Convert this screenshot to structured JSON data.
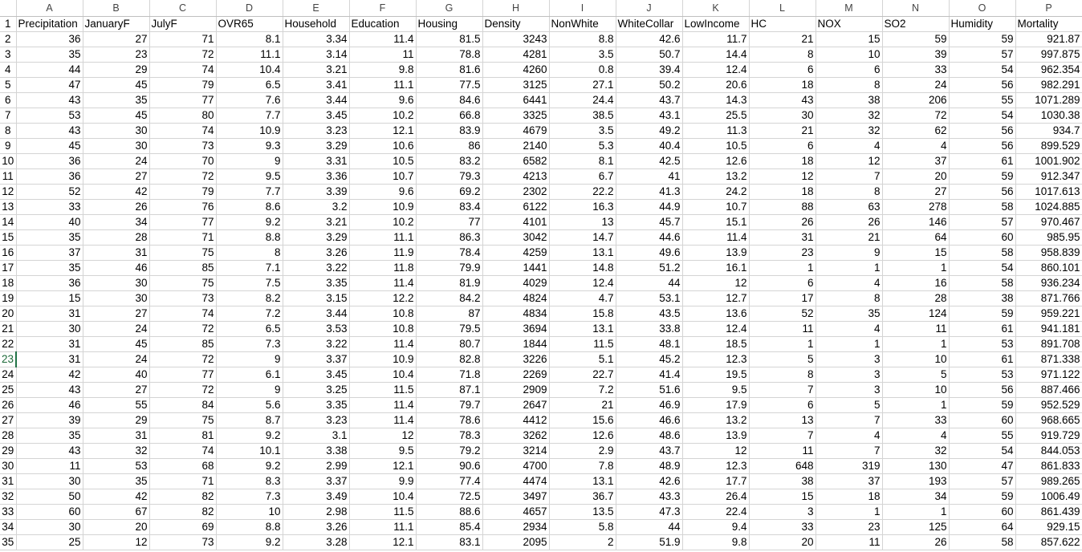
{
  "columns": [
    "A",
    "B",
    "C",
    "D",
    "E",
    "F",
    "G",
    "H",
    "I",
    "J",
    "K",
    "L",
    "M",
    "N",
    "O",
    "P"
  ],
  "headers": [
    "Precipitation",
    "JanuaryF",
    "JulyF",
    "OVR65",
    "Household",
    "Education",
    "Housing",
    "Density",
    "NonWhite",
    "WhiteCollar",
    "LowIncome",
    "HC",
    "NOX",
    "SO2",
    "Humidity",
    "Mortality"
  ],
  "selected_row": 23,
  "rows": [
    [
      "36",
      "27",
      "71",
      "8.1",
      "3.34",
      "11.4",
      "81.5",
      "3243",
      "8.8",
      "42.6",
      "11.7",
      "21",
      "15",
      "59",
      "59",
      "921.87"
    ],
    [
      "35",
      "23",
      "72",
      "11.1",
      "3.14",
      "11",
      "78.8",
      "4281",
      "3.5",
      "50.7",
      "14.4",
      "8",
      "10",
      "39",
      "57",
      "997.875"
    ],
    [
      "44",
      "29",
      "74",
      "10.4",
      "3.21",
      "9.8",
      "81.6",
      "4260",
      "0.8",
      "39.4",
      "12.4",
      "6",
      "6",
      "33",
      "54",
      "962.354"
    ],
    [
      "47",
      "45",
      "79",
      "6.5",
      "3.41",
      "11.1",
      "77.5",
      "3125",
      "27.1",
      "50.2",
      "20.6",
      "18",
      "8",
      "24",
      "56",
      "982.291"
    ],
    [
      "43",
      "35",
      "77",
      "7.6",
      "3.44",
      "9.6",
      "84.6",
      "6441",
      "24.4",
      "43.7",
      "14.3",
      "43",
      "38",
      "206",
      "55",
      "1071.289"
    ],
    [
      "53",
      "45",
      "80",
      "7.7",
      "3.45",
      "10.2",
      "66.8",
      "3325",
      "38.5",
      "43.1",
      "25.5",
      "30",
      "32",
      "72",
      "54",
      "1030.38"
    ],
    [
      "43",
      "30",
      "74",
      "10.9",
      "3.23",
      "12.1",
      "83.9",
      "4679",
      "3.5",
      "49.2",
      "11.3",
      "21",
      "32",
      "62",
      "56",
      "934.7"
    ],
    [
      "45",
      "30",
      "73",
      "9.3",
      "3.29",
      "10.6",
      "86",
      "2140",
      "5.3",
      "40.4",
      "10.5",
      "6",
      "4",
      "4",
      "56",
      "899.529"
    ],
    [
      "36",
      "24",
      "70",
      "9",
      "3.31",
      "10.5",
      "83.2",
      "6582",
      "8.1",
      "42.5",
      "12.6",
      "18",
      "12",
      "37",
      "61",
      "1001.902"
    ],
    [
      "36",
      "27",
      "72",
      "9.5",
      "3.36",
      "10.7",
      "79.3",
      "4213",
      "6.7",
      "41",
      "13.2",
      "12",
      "7",
      "20",
      "59",
      "912.347"
    ],
    [
      "52",
      "42",
      "79",
      "7.7",
      "3.39",
      "9.6",
      "69.2",
      "2302",
      "22.2",
      "41.3",
      "24.2",
      "18",
      "8",
      "27",
      "56",
      "1017.613"
    ],
    [
      "33",
      "26",
      "76",
      "8.6",
      "3.2",
      "10.9",
      "83.4",
      "6122",
      "16.3",
      "44.9",
      "10.7",
      "88",
      "63",
      "278",
      "58",
      "1024.885"
    ],
    [
      "40",
      "34",
      "77",
      "9.2",
      "3.21",
      "10.2",
      "77",
      "4101",
      "13",
      "45.7",
      "15.1",
      "26",
      "26",
      "146",
      "57",
      "970.467"
    ],
    [
      "35",
      "28",
      "71",
      "8.8",
      "3.29",
      "11.1",
      "86.3",
      "3042",
      "14.7",
      "44.6",
      "11.4",
      "31",
      "21",
      "64",
      "60",
      "985.95"
    ],
    [
      "37",
      "31",
      "75",
      "8",
      "3.26",
      "11.9",
      "78.4",
      "4259",
      "13.1",
      "49.6",
      "13.9",
      "23",
      "9",
      "15",
      "58",
      "958.839"
    ],
    [
      "35",
      "46",
      "85",
      "7.1",
      "3.22",
      "11.8",
      "79.9",
      "1441",
      "14.8",
      "51.2",
      "16.1",
      "1",
      "1",
      "1",
      "54",
      "860.101"
    ],
    [
      "36",
      "30",
      "75",
      "7.5",
      "3.35",
      "11.4",
      "81.9",
      "4029",
      "12.4",
      "44",
      "12",
      "6",
      "4",
      "16",
      "58",
      "936.234"
    ],
    [
      "15",
      "30",
      "73",
      "8.2",
      "3.15",
      "12.2",
      "84.2",
      "4824",
      "4.7",
      "53.1",
      "12.7",
      "17",
      "8",
      "28",
      "38",
      "871.766"
    ],
    [
      "31",
      "27",
      "74",
      "7.2",
      "3.44",
      "10.8",
      "87",
      "4834",
      "15.8",
      "43.5",
      "13.6",
      "52",
      "35",
      "124",
      "59",
      "959.221"
    ],
    [
      "30",
      "24",
      "72",
      "6.5",
      "3.53",
      "10.8",
      "79.5",
      "3694",
      "13.1",
      "33.8",
      "12.4",
      "11",
      "4",
      "11",
      "61",
      "941.181"
    ],
    [
      "31",
      "45",
      "85",
      "7.3",
      "3.22",
      "11.4",
      "80.7",
      "1844",
      "11.5",
      "48.1",
      "18.5",
      "1",
      "1",
      "1",
      "53",
      "891.708"
    ],
    [
      "31",
      "24",
      "72",
      "9",
      "3.37",
      "10.9",
      "82.8",
      "3226",
      "5.1",
      "45.2",
      "12.3",
      "5",
      "3",
      "10",
      "61",
      "871.338"
    ],
    [
      "42",
      "40",
      "77",
      "6.1",
      "3.45",
      "10.4",
      "71.8",
      "2269",
      "22.7",
      "41.4",
      "19.5",
      "8",
      "3",
      "5",
      "53",
      "971.122"
    ],
    [
      "43",
      "27",
      "72",
      "9",
      "3.25",
      "11.5",
      "87.1",
      "2909",
      "7.2",
      "51.6",
      "9.5",
      "7",
      "3",
      "10",
      "56",
      "887.466"
    ],
    [
      "46",
      "55",
      "84",
      "5.6",
      "3.35",
      "11.4",
      "79.7",
      "2647",
      "21",
      "46.9",
      "17.9",
      "6",
      "5",
      "1",
      "59",
      "952.529"
    ],
    [
      "39",
      "29",
      "75",
      "8.7",
      "3.23",
      "11.4",
      "78.6",
      "4412",
      "15.6",
      "46.6",
      "13.2",
      "13",
      "7",
      "33",
      "60",
      "968.665"
    ],
    [
      "35",
      "31",
      "81",
      "9.2",
      "3.1",
      "12",
      "78.3",
      "3262",
      "12.6",
      "48.6",
      "13.9",
      "7",
      "4",
      "4",
      "55",
      "919.729"
    ],
    [
      "43",
      "32",
      "74",
      "10.1",
      "3.38",
      "9.5",
      "79.2",
      "3214",
      "2.9",
      "43.7",
      "12",
      "11",
      "7",
      "32",
      "54",
      "844.053"
    ],
    [
      "11",
      "53",
      "68",
      "9.2",
      "2.99",
      "12.1",
      "90.6",
      "4700",
      "7.8",
      "48.9",
      "12.3",
      "648",
      "319",
      "130",
      "47",
      "861.833"
    ],
    [
      "30",
      "35",
      "71",
      "8.3",
      "3.37",
      "9.9",
      "77.4",
      "4474",
      "13.1",
      "42.6",
      "17.7",
      "38",
      "37",
      "193",
      "57",
      "989.265"
    ],
    [
      "50",
      "42",
      "82",
      "7.3",
      "3.49",
      "10.4",
      "72.5",
      "3497",
      "36.7",
      "43.3",
      "26.4",
      "15",
      "18",
      "34",
      "59",
      "1006.49"
    ],
    [
      "60",
      "67",
      "82",
      "10",
      "2.98",
      "11.5",
      "88.6",
      "4657",
      "13.5",
      "47.3",
      "22.4",
      "3",
      "1",
      "1",
      "60",
      "861.439"
    ],
    [
      "30",
      "20",
      "69",
      "8.8",
      "3.26",
      "11.1",
      "85.4",
      "2934",
      "5.8",
      "44",
      "9.4",
      "33",
      "23",
      "125",
      "64",
      "929.15"
    ],
    [
      "25",
      "12",
      "73",
      "9.2",
      "3.28",
      "12.1",
      "83.1",
      "2095",
      "2",
      "51.9",
      "9.8",
      "20",
      "11",
      "26",
      "58",
      "857.622"
    ]
  ]
}
